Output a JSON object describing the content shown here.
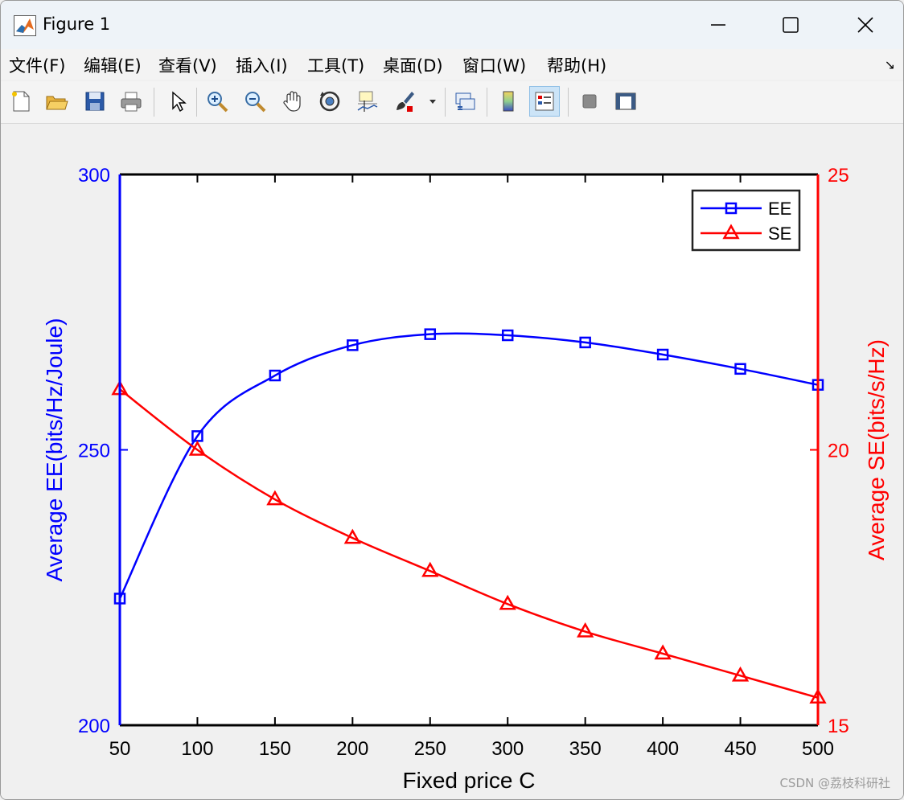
{
  "window": {
    "title": "Figure 1"
  },
  "menu": [
    "文件(F)",
    "编辑(E)",
    "查看(V)",
    "插入(I)",
    "工具(T)",
    "桌面(D)",
    "窗口(W)",
    "帮助(H)"
  ],
  "toolbar_icons": [
    "new-file-icon",
    "open-folder-icon",
    "save-icon",
    "print-icon",
    "pointer-icon",
    "zoom-in-icon",
    "zoom-out-icon",
    "pan-hand-icon",
    "rotate-3d-icon",
    "data-cursor-icon",
    "brush-icon",
    "link-plot-icon",
    "colorbar-icon",
    "legend-icon",
    "hide-plot-tools-icon",
    "show-plot-tools-icon"
  ],
  "chart_data": {
    "type": "line",
    "xlabel": "Fixed price C",
    "ylabel_left": "Average EE(bits/Hz/Joule)",
    "ylabel_right": "Average SE(bits/s/Hz)",
    "x": [
      50,
      100,
      150,
      200,
      250,
      300,
      350,
      400,
      450,
      500
    ],
    "xlim": [
      50,
      500
    ],
    "xticks": [
      "50",
      "100",
      "150",
      "200",
      "250",
      "300",
      "350",
      "400",
      "450",
      "500"
    ],
    "ylim_left": [
      200,
      300
    ],
    "yticks_left": [
      "200",
      "250",
      "300"
    ],
    "ylim_right": [
      15,
      25
    ],
    "yticks_right": [
      "15",
      "20",
      "25"
    ],
    "legend_position": "top-right",
    "grid": false,
    "series": [
      {
        "name": "EE",
        "axis": "left",
        "color": "#0000ff",
        "marker": "square",
        "values": [
          223,
          252.5,
          263.5,
          269,
          271,
          270.8,
          269.5,
          267.3,
          264.7,
          261.8
        ]
      },
      {
        "name": "SE",
        "axis": "right",
        "color": "#ff0000",
        "marker": "triangle",
        "values": [
          21.1,
          20.0,
          19.1,
          18.4,
          17.8,
          17.2,
          16.7,
          16.3,
          15.9,
          15.5
        ]
      }
    ]
  },
  "watermark": "CSDN @荔枝科研社"
}
